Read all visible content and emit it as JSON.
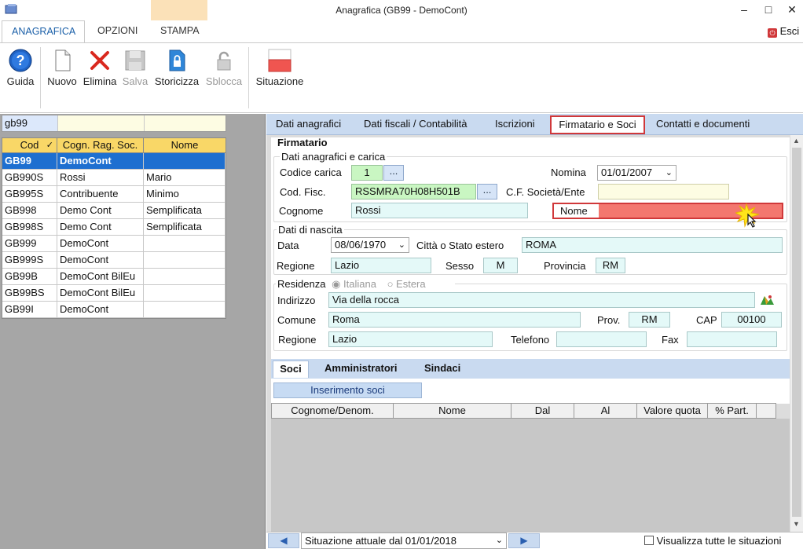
{
  "window": {
    "title": "Anagrafica (GB99 - DemoCont)",
    "exit_label": "Esci"
  },
  "menu": {
    "tabs": [
      "ANAGRAFICA",
      "OPZIONI",
      "STAMPA"
    ]
  },
  "ribbon": {
    "buttons": [
      {
        "label": "Guida",
        "enabled": true
      },
      {
        "label": "Nuovo",
        "enabled": true
      },
      {
        "label": "Elimina",
        "enabled": true
      },
      {
        "label": "Salva",
        "enabled": false
      },
      {
        "label": "Storicizza",
        "enabled": true
      },
      {
        "label": "Sblocca",
        "enabled": false
      },
      {
        "label": "Situazione",
        "enabled": true
      }
    ]
  },
  "filter": {
    "code_value": "gb99"
  },
  "grid": {
    "headers": [
      "Cod",
      "Cogn. Rag. Soc.",
      "Nome"
    ],
    "rows": [
      {
        "cod": "GB99",
        "rag": "DemoCont",
        "nome": "",
        "selected": true
      },
      {
        "cod": "GB990S",
        "rag": "Rossi",
        "nome": "Mario"
      },
      {
        "cod": "GB995S",
        "rag": "Contribuente",
        "nome": "Minimo"
      },
      {
        "cod": "GB998",
        "rag": "Demo Cont",
        "nome": "Semplificata"
      },
      {
        "cod": "GB998S",
        "rag": "Demo Cont",
        "nome": "Semplificata"
      },
      {
        "cod": "GB999",
        "rag": "DemoCont",
        "nome": ""
      },
      {
        "cod": "GB999S",
        "rag": "DemoCont",
        "nome": ""
      },
      {
        "cod": "GB99B",
        "rag": "DemoCont BilEu",
        "nome": ""
      },
      {
        "cod": "GB99BS",
        "rag": "DemoCont BilEu",
        "nome": ""
      },
      {
        "cod": "GB99I",
        "rag": "DemoCont",
        "nome": ""
      }
    ]
  },
  "tabs": [
    "Dati anagrafici",
    "Dati fiscali / Contabilità",
    "Iscrizioni",
    "Firmatario e Soci",
    "Contatti e documenti"
  ],
  "firmatario": {
    "section": "Firmatario",
    "group1": "Dati anagrafici e carica",
    "codice_carica_label": "Codice carica",
    "codice_carica": "1",
    "nomina_label": "Nomina",
    "nomina": "01/01/2007",
    "cod_fisc_label": "Cod. Fisc.",
    "cod_fisc": "RSSMRA70H08H501B",
    "cf_soc_label": "C.F. Società/Ente",
    "cf_soc": "",
    "cognome_label": "Cognome",
    "cognome": "Rossi",
    "nome_label": "Nome",
    "nome": "",
    "dots": "..."
  },
  "nascita": {
    "group": "Dati di nascita",
    "data_label": "Data",
    "data": "08/06/1970",
    "citta_label": "Città o Stato estero",
    "citta": "ROMA",
    "regione_label": "Regione",
    "regione": "Lazio",
    "sesso_label": "Sesso",
    "sesso": "M",
    "provincia_label": "Provincia",
    "provincia": "RM"
  },
  "residenza": {
    "group": "Residenza",
    "opt_italiana": "Italiana",
    "opt_estera": "Estera",
    "indirizzo_label": "Indirizzo",
    "indirizzo": "Via della rocca",
    "comune_label": "Comune",
    "comune": "Roma",
    "prov_label": "Prov.",
    "prov": "RM",
    "cap_label": "CAP",
    "cap": "00100",
    "regione_label": "Regione",
    "regione": "Lazio",
    "telefono_label": "Telefono",
    "telefono": "",
    "fax_label": "Fax",
    "fax": ""
  },
  "soci": {
    "tabs": [
      "Soci",
      "Amministratori",
      "Sindaci"
    ],
    "insert_button": "Inserimento soci",
    "headers": [
      "Cognome/Denom.",
      "Nome",
      "Dal",
      "Al",
      "Valore quota",
      "% Part."
    ]
  },
  "bottom": {
    "situazione": "Situazione attuale dal 01/01/2018",
    "show_all_label": "Visualizza tutte le situazioni"
  },
  "colors": {
    "accent_blue": "#1e6fd0",
    "header_yellow": "#f9d767",
    "highlight_red": "#d0383a",
    "nome_fill": "#f3776f"
  }
}
